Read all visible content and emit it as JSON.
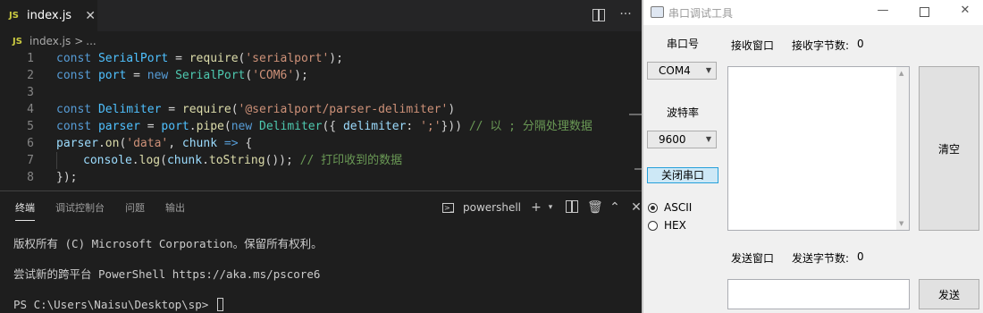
{
  "editor": {
    "tab": {
      "badge": "JS",
      "label": "index.js",
      "close": "✕"
    },
    "actions": {
      "more": "···"
    },
    "breadcrumb": {
      "badge": "JS",
      "file": "index.js",
      "sep": ">",
      "more": "..."
    },
    "lines": [
      {
        "n": "1",
        "tokens": [
          [
            "kw",
            "const "
          ],
          [
            "var",
            "SerialPort"
          ],
          [
            "pun",
            " = "
          ],
          [
            "fn",
            "require"
          ],
          [
            "pun",
            "("
          ],
          [
            "str",
            "'serialport'"
          ],
          [
            "pun",
            ");"
          ]
        ]
      },
      {
        "n": "2",
        "tokens": [
          [
            "kw",
            "const "
          ],
          [
            "var",
            "port"
          ],
          [
            "pun",
            " = "
          ],
          [
            "kw",
            "new "
          ],
          [
            "cls",
            "SerialPort"
          ],
          [
            "pun",
            "("
          ],
          [
            "str",
            "'COM6'"
          ],
          [
            "pun",
            ");"
          ]
        ]
      },
      {
        "n": "3",
        "tokens": []
      },
      {
        "n": "4",
        "tokens": [
          [
            "kw",
            "const "
          ],
          [
            "var",
            "Delimiter"
          ],
          [
            "pun",
            " = "
          ],
          [
            "fn",
            "require"
          ],
          [
            "pun",
            "("
          ],
          [
            "str",
            "'@serialport/parser-delimiter'"
          ],
          [
            "pun",
            ")"
          ]
        ]
      },
      {
        "n": "5",
        "tokens": [
          [
            "kw",
            "const "
          ],
          [
            "var",
            "parser"
          ],
          [
            "pun",
            " = "
          ],
          [
            "var",
            "port"
          ],
          [
            "pun",
            "."
          ],
          [
            "fn",
            "pipe"
          ],
          [
            "pun",
            "("
          ],
          [
            "kw",
            "new "
          ],
          [
            "cls",
            "Delimiter"
          ],
          [
            "pun",
            "({ "
          ],
          [
            "prm",
            "delimiter"
          ],
          [
            "pun",
            ": "
          ],
          [
            "str",
            "';'"
          ],
          [
            "pun",
            "})) "
          ],
          [
            "cmt",
            "// 以 ; 分隔处理数据"
          ]
        ]
      },
      {
        "n": "6",
        "tokens": [
          [
            "prm",
            "parser"
          ],
          [
            "pun",
            "."
          ],
          [
            "fn",
            "on"
          ],
          [
            "pun",
            "("
          ],
          [
            "str",
            "'data'"
          ],
          [
            "pun",
            ", "
          ],
          [
            "prm",
            "chunk"
          ],
          [
            "pun",
            " "
          ],
          [
            "kw",
            "=>"
          ],
          [
            "pun",
            " {"
          ]
        ]
      },
      {
        "n": "7",
        "indent": true,
        "tokens": [
          [
            "prm",
            "console"
          ],
          [
            "pun",
            "."
          ],
          [
            "fn",
            "log"
          ],
          [
            "pun",
            "("
          ],
          [
            "prm",
            "chunk"
          ],
          [
            "pun",
            "."
          ],
          [
            "fn",
            "toString"
          ],
          [
            "pun",
            "()); "
          ],
          [
            "cmt",
            "// 打印收到的数据"
          ]
        ]
      },
      {
        "n": "8",
        "tokens": [
          [
            "pun",
            "});"
          ]
        ]
      }
    ]
  },
  "panel": {
    "tabs": [
      "终端",
      "调试控制台",
      "问题",
      "输出"
    ],
    "shell": "powershell",
    "terminal": {
      "line1": "版权所有 (C) Microsoft Corporation。保留所有权利。",
      "line2": "尝试新的跨平台 PowerShell https://aka.ms/pscore6",
      "prompt": "PS C:\\Users\\Naisu\\Desktop\\sp> "
    }
  },
  "serial_tool": {
    "title": "串口调试工具",
    "port_label": "串口号",
    "port_value": "COM4",
    "baud_label": "波特率",
    "baud_value": "9600",
    "close_port_button": "关闭串口",
    "mode_ascii": "ASCII",
    "mode_hex": "HEX",
    "selected_mode": "ASCII",
    "recv_label": "接收窗口",
    "recv_bytes_label": "接收字节数:",
    "recv_bytes": "0",
    "clear_button": "清空",
    "send_label": "发送窗口",
    "send_bytes_label": "发送字节数:",
    "send_bytes": "0",
    "send_button": "发送"
  }
}
